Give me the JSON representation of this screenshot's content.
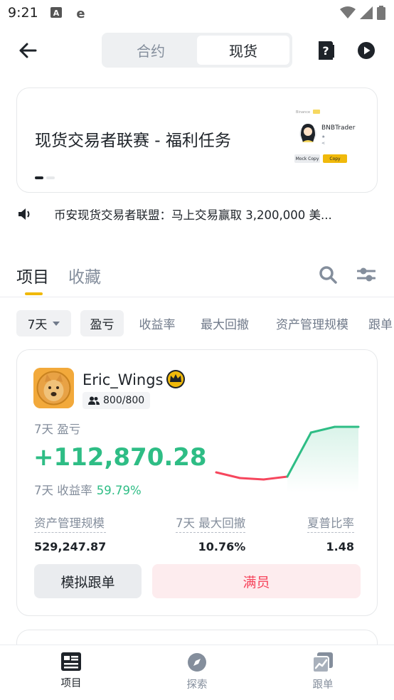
{
  "status_bar": {
    "time": "9:21"
  },
  "header": {
    "segments": [
      "合约",
      "现货"
    ],
    "active_segment": "现货"
  },
  "banner": {
    "title": "现货交易者联赛 - 福利任务",
    "art_name": "BNBTrader",
    "art_mock": "Mock Copy",
    "art_copy": "Copy"
  },
  "notice": {
    "text": "币安现货交易者联盟：马上交易赢取 3,200,000 美..."
  },
  "tabs": [
    {
      "label": "项目",
      "active": true
    },
    {
      "label": "收藏",
      "active": false
    }
  ],
  "filters": {
    "period": "7天",
    "chips": [
      "盈亏",
      "收益率",
      "最大回撤",
      "资产管理规模",
      "跟单"
    ]
  },
  "trader": {
    "name": "Eric_Wings",
    "followers": "800/800",
    "pnl_label": "7天 盈亏",
    "pnl_value": "+112,870.28",
    "roi_label": "7天  收益率",
    "roi_value": "59.79%",
    "metrics": [
      {
        "label": "资产管理规模",
        "value": "529,247.87"
      },
      {
        "label": "7天 最大回撤",
        "value": "10.76%"
      },
      {
        "label": "夏普比率",
        "value": "1.48"
      }
    ],
    "mock_button": "模拟跟单",
    "full_button": "满员",
    "chart_data": {
      "type": "line",
      "values": [
        0.08,
        0.0,
        -0.02,
        0.02,
        0.64,
        0.72,
        0.72
      ],
      "colors": {
        "down": "#f6465d",
        "up": "#2ebd85"
      }
    }
  },
  "bottom_nav": [
    {
      "label": "项目",
      "icon": "list-icon",
      "active": true
    },
    {
      "label": "探索",
      "icon": "compass-icon",
      "active": false
    },
    {
      "label": "跟单",
      "icon": "copy-chart-icon",
      "active": false
    }
  ],
  "colors": {
    "accent": "#f0b90b",
    "green": "#2ebd85",
    "red": "#f6465d"
  }
}
